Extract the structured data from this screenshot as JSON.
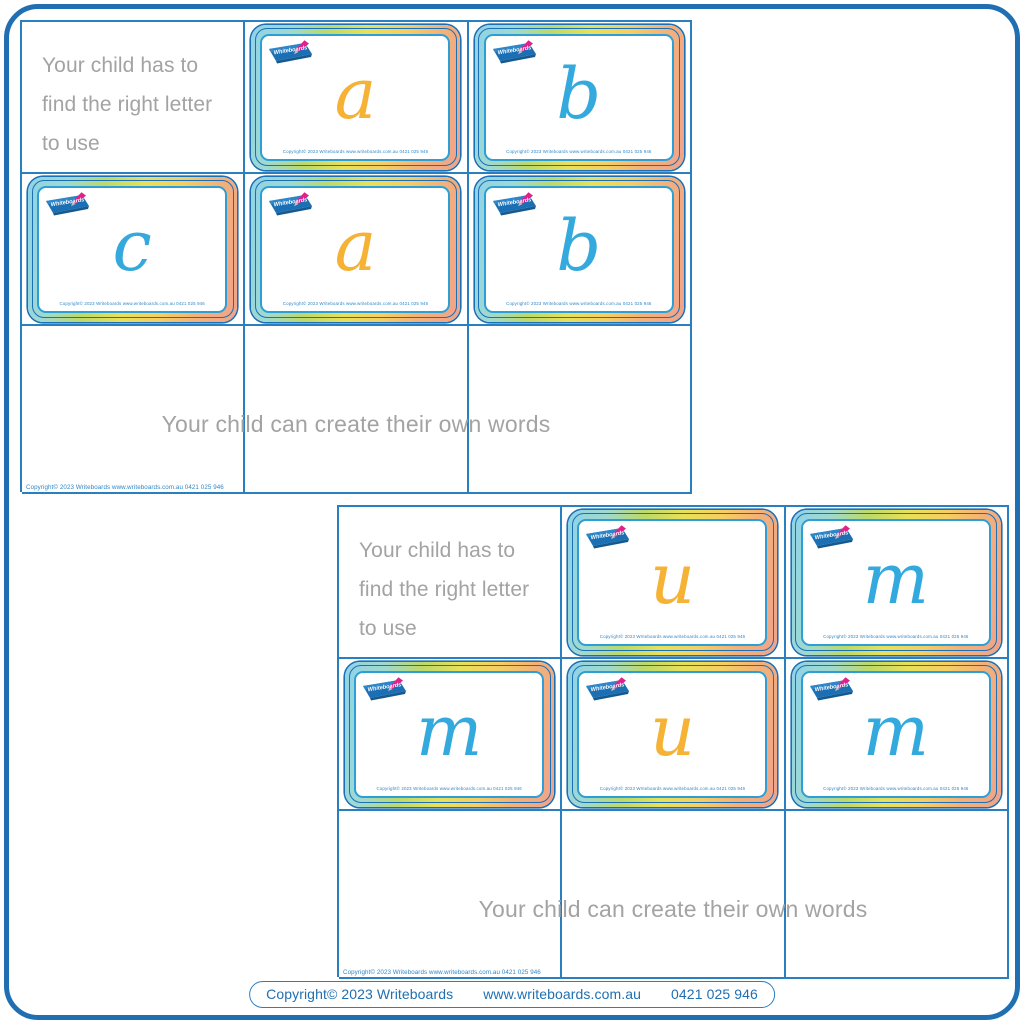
{
  "page": {
    "background_color": "#ffffff",
    "frame_color": "#1f6fb2"
  },
  "colors": {
    "grid_border": "#2a7fc1",
    "instruction_text": "#a3a3a3",
    "letter_blue": "#33a9dd",
    "letter_orange": "#f5b235",
    "copyright_blue": "#2f86c6",
    "logo_blue": "#1b6fb5",
    "marker_pink": "#e0218a"
  },
  "footer": {
    "copyright": "Copyright© 2023 Writeboards",
    "website": "www.writeboards.com.au",
    "phone": "0421 025 946"
  },
  "board_copyright": "Copyright© 2023 Writeboards     www.writeboards.com.au     0421 025 946",
  "grid_copyright": "Copyright© 2023 Writeboards     www.writeboards.com.au    0421 025 946",
  "logo": {
    "text": "Whiteboards",
    "icon": "whiteboard-logo-with-marker-icon"
  },
  "grids": [
    {
      "id": "worksheet-grid-1",
      "instruction": "Your child has to find the right letter to use",
      "footer_note": "Your child can create their own words",
      "rows": [
        [
          {
            "type": "text"
          },
          {
            "type": "card",
            "letter": "a",
            "color": "orange"
          },
          {
            "type": "card",
            "letter": "b",
            "color": "blue"
          }
        ],
        [
          {
            "type": "card",
            "letter": "c",
            "color": "blue"
          },
          {
            "type": "card",
            "letter": "a",
            "color": "orange"
          },
          {
            "type": "card",
            "letter": "b",
            "color": "blue"
          }
        ],
        [
          {
            "type": "empty"
          },
          {
            "type": "empty"
          },
          {
            "type": "empty"
          }
        ]
      ]
    },
    {
      "id": "worksheet-grid-2",
      "instruction": "Your child has to find the right letter to use",
      "footer_note": "Your child can create their own words",
      "rows": [
        [
          {
            "type": "text"
          },
          {
            "type": "card",
            "letter": "u",
            "color": "orange"
          },
          {
            "type": "card",
            "letter": "m",
            "color": "blue"
          }
        ],
        [
          {
            "type": "card",
            "letter": "m",
            "color": "blue"
          },
          {
            "type": "card",
            "letter": "u",
            "color": "orange"
          },
          {
            "type": "card",
            "letter": "m",
            "color": "blue"
          }
        ],
        [
          {
            "type": "empty"
          },
          {
            "type": "empty"
          },
          {
            "type": "empty"
          }
        ]
      ]
    }
  ]
}
